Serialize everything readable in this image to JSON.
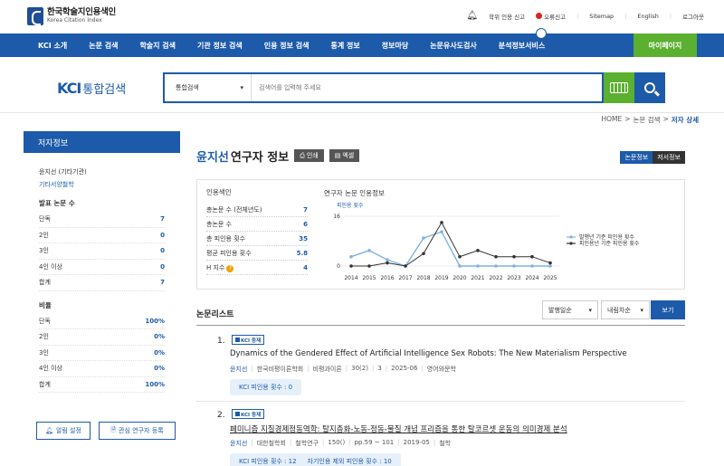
{
  "header": {
    "logo_ko": "한국학술지인용색인",
    "logo_en": "Korea Citation Index",
    "utils": [
      "학위 인용 신고",
      "오류신고",
      "Sitemap",
      "English",
      "로그아웃"
    ]
  },
  "nav": {
    "items": [
      "KCI 소개",
      "논문 검색",
      "학술지 검색",
      "기관 정보 검색",
      "인용 정보 검색",
      "통계 정보",
      "정보마당",
      "논문유사도검사",
      "분석정보서비스"
    ],
    "mypage": "마이페이지"
  },
  "search": {
    "logo_kci": "KCI",
    "logo_text": "통합검색",
    "select_value": "통합검색",
    "placeholder": "검색어를 입력해 주세요"
  },
  "breadcrumb": [
    "HOME",
    ">",
    "논문 검색",
    ">",
    "저자 상세"
  ],
  "sidebar": {
    "title": "저자정보",
    "author": "윤지선 (기타기관)",
    "institution": "기타서양철학",
    "sec1": "발표 논문 수",
    "counts": [
      {
        "label": "단독",
        "value": "7"
      },
      {
        "label": "2인",
        "value": "0"
      },
      {
        "label": "3인",
        "value": "0"
      },
      {
        "label": "4인 이상",
        "value": "0"
      },
      {
        "label": "합계",
        "value": "7"
      }
    ],
    "sec2": "비율",
    "ratios": [
      {
        "label": "단독",
        "value": "100%"
      },
      {
        "label": "2인",
        "value": "0%"
      },
      {
        "label": "3인",
        "value": "0%"
      },
      {
        "label": "4인 이상",
        "value": "0%"
      },
      {
        "label": "합계",
        "value": "100%"
      }
    ],
    "btn_alert": "알림 설정",
    "btn_fav": "관심 연구자 등록"
  },
  "main": {
    "name": "윤지선",
    "title_rest": "연구자 정보",
    "print": "인쇄",
    "excel": "엑셀",
    "tab_paper": "논문정보",
    "tab_book": "저서정보",
    "index_title": "인용색인",
    "index_rows": [
      {
        "label": "총논문 수 (전체년도)",
        "value": "7"
      },
      {
        "label": "총논문 수",
        "value": "6"
      },
      {
        "label": "총 피인용 횟수",
        "value": "35"
      },
      {
        "label": "평균 피인용 횟수",
        "value": "5.8"
      },
      {
        "label": "H 지수",
        "value": "4"
      }
    ],
    "chart_title": "연구자 논문 인용정보",
    "list_title": "논문리스트",
    "sort1": "발행일순",
    "sort2": "내림차순",
    "view": "보기"
  },
  "chart_data": {
    "type": "line",
    "title": "연구자 논문 인용정보",
    "ylabel": "피인용 횟수",
    "x": [
      "2014",
      "2015",
      "2016",
      "2017",
      "2018",
      "2019",
      "2020",
      "2021",
      "2022",
      "2023",
      "2024",
      "2025"
    ],
    "yticks": [
      "16",
      "0"
    ],
    "ylim": [
      0,
      16
    ],
    "series": [
      {
        "name": "발행년 기준 피인용 횟수",
        "color": "#7fb2e5",
        "values": [
          3,
          5,
          2,
          0,
          9,
          11,
          0,
          0,
          0,
          0,
          0,
          0
        ]
      },
      {
        "name": "피인용년 기준 피인용 횟수",
        "color": "#333333",
        "values": [
          0,
          0,
          1,
          0,
          4,
          14,
          3,
          5,
          3,
          3,
          3,
          1
        ]
      }
    ],
    "legend": "right"
  },
  "papers": [
    {
      "num": "1.",
      "badge": "KCI 등재",
      "title": "Dynamics of the Gendered Effect of Artificial Intelligence Sex Robots: The New Materialism Perspective",
      "author": "윤지선",
      "journal": "한국비평이론학회",
      "venue": "비평과이론",
      "vol": "30(2)",
      "pages": "3",
      "date": "2025-06",
      "field": "영어와문학",
      "cite": "KCI 피인용 횟수 : 0",
      "cite2": ""
    },
    {
      "num": "2.",
      "badge": "KCI 등재",
      "title": "페미니즘 지질경제정동역학: 탈지층화-노동-정동-물질 개념 프리즘을 통한 탈코르셋 운동의 의미경제 분석",
      "author": "윤지선",
      "journal": "대한철학회",
      "venue": "철학연구",
      "vol": "150()",
      "pages": "pp.59 ~ 101",
      "date": "2019-05",
      "field": "철학",
      "cite": "KCI 피인용 횟수 : 12",
      "cite2": "자기인용 제외 피인용 횟수 : 10"
    }
  ]
}
